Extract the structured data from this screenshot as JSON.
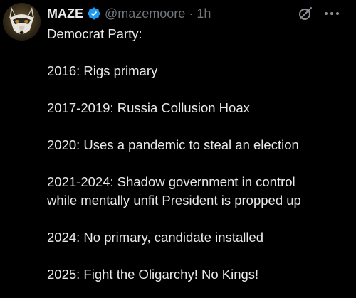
{
  "author": {
    "display_name": "MAZE",
    "handle": "@mazemoore",
    "separator": "·",
    "time": "1h",
    "verified": true
  },
  "colors": {
    "background": "#000000",
    "text": "#e7e9ea",
    "secondary": "#71767b",
    "verified_badge": "#1d9bf0"
  },
  "icons": {
    "avatar": "wolf-avatar",
    "badge": "verified-badge-icon",
    "grok": "grok-icon",
    "more": "more-options-icon"
  },
  "tweet": {
    "lines": [
      "Democrat Party:",
      "",
      "2016: Rigs primary",
      "",
      "2017-2019: Russia Collusion Hoax",
      "",
      "2020: Uses a pandemic to steal an election",
      "",
      "2021-2024: Shadow government in control",
      "while mentally unfit President is propped up",
      "",
      "2024: No primary, candidate installed",
      "",
      "2025: Fight the Oligarchy! No Kings!"
    ]
  }
}
